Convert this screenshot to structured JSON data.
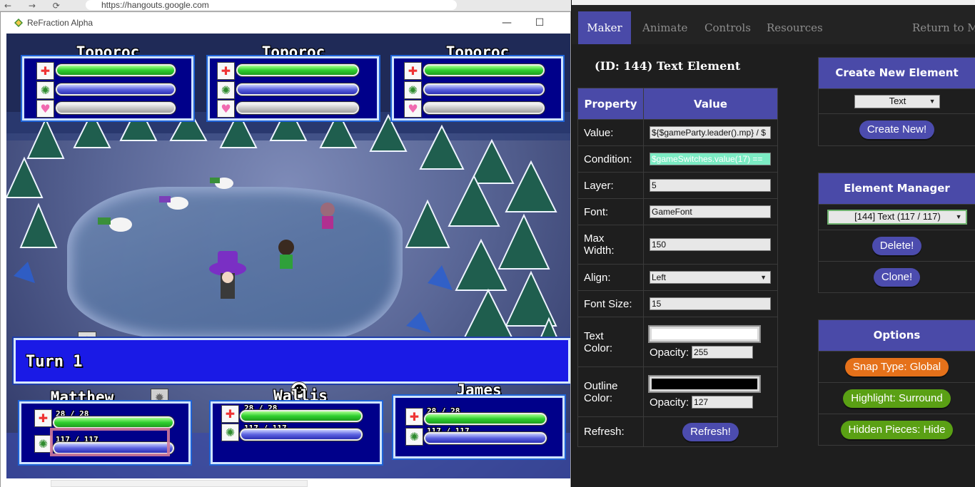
{
  "browser": {
    "url": "https://hangouts.google.com"
  },
  "game_window": {
    "title": "ReFraction Alpha",
    "controls": {
      "minimize": "—",
      "maximize": "☐",
      "close": "✕"
    },
    "enemies": [
      {
        "name": "Toporoc",
        "hp_fraction": 1.0,
        "mp_fraction": 1.0,
        "love_fraction": 1.0
      },
      {
        "name": "Toporoc",
        "hp_fraction": 1.0,
        "mp_fraction": 1.0,
        "love_fraction": 1.0
      },
      {
        "name": "Toporoc",
        "hp_fraction": 1.0,
        "mp_fraction": 1.0,
        "love_fraction": 1.0
      }
    ],
    "turn_text": "Turn 1",
    "party": [
      {
        "name": "Matthew",
        "hp_text": "28 / 28",
        "mp_text": "117 / 117"
      },
      {
        "name": "Wallis",
        "hp_text": "28 / 28",
        "mp_text": "117 / 117"
      },
      {
        "name": "James",
        "hp_text": "28 / 28",
        "mp_text": "117 / 117"
      }
    ]
  },
  "editor": {
    "tabs": [
      "Maker",
      "Animate",
      "Controls",
      "Resources"
    ],
    "active_tab": "Maker",
    "return_link": "Return to Mai",
    "element_title": "(ID: 144) Text Element",
    "table_headers": {
      "property": "Property",
      "value": "Value"
    },
    "properties": {
      "value": {
        "label": "Value:",
        "val": "${$gameParty.leader().mp} / $"
      },
      "condition": {
        "label": "Condition:",
        "val": "$gameSwitches.value(17) =="
      },
      "layer": {
        "label": "Layer:",
        "val": "5"
      },
      "font": {
        "label": "Font:",
        "val": "GameFont"
      },
      "max_width": {
        "label": "Max Width:",
        "val": "150"
      },
      "align": {
        "label": "Align:",
        "val": "Left"
      },
      "font_size": {
        "label": "Font Size:",
        "val": "15"
      },
      "text_color": {
        "label": "Text Color:",
        "color": "#ffffff",
        "opacity_label": "Opacity:",
        "opacity": "255"
      },
      "outline_color": {
        "label": "Outline Color:",
        "color": "#000000",
        "opacity_label": "Opacity:",
        "opacity": "127"
      },
      "refresh": {
        "label": "Refresh:",
        "button": "Refresh!"
      }
    },
    "create_panel": {
      "title": "Create New Element",
      "type_value": "Text",
      "button": "Create New!"
    },
    "manager_panel": {
      "title": "Element Manager",
      "selected": "[144] Text (117 / 117)",
      "delete_button": "Delete!",
      "clone_button": "Clone!"
    },
    "options_panel": {
      "title": "Options",
      "snap": "Snap Type: Global",
      "highlight": "Highlight: Surround",
      "hidden": "Hidden Pieces: Hide"
    },
    "colors": {
      "accent": "#4a4aa8",
      "orange": "#e5711a",
      "green": "#5aa014",
      "highlight_input": "#7cecc4"
    }
  }
}
